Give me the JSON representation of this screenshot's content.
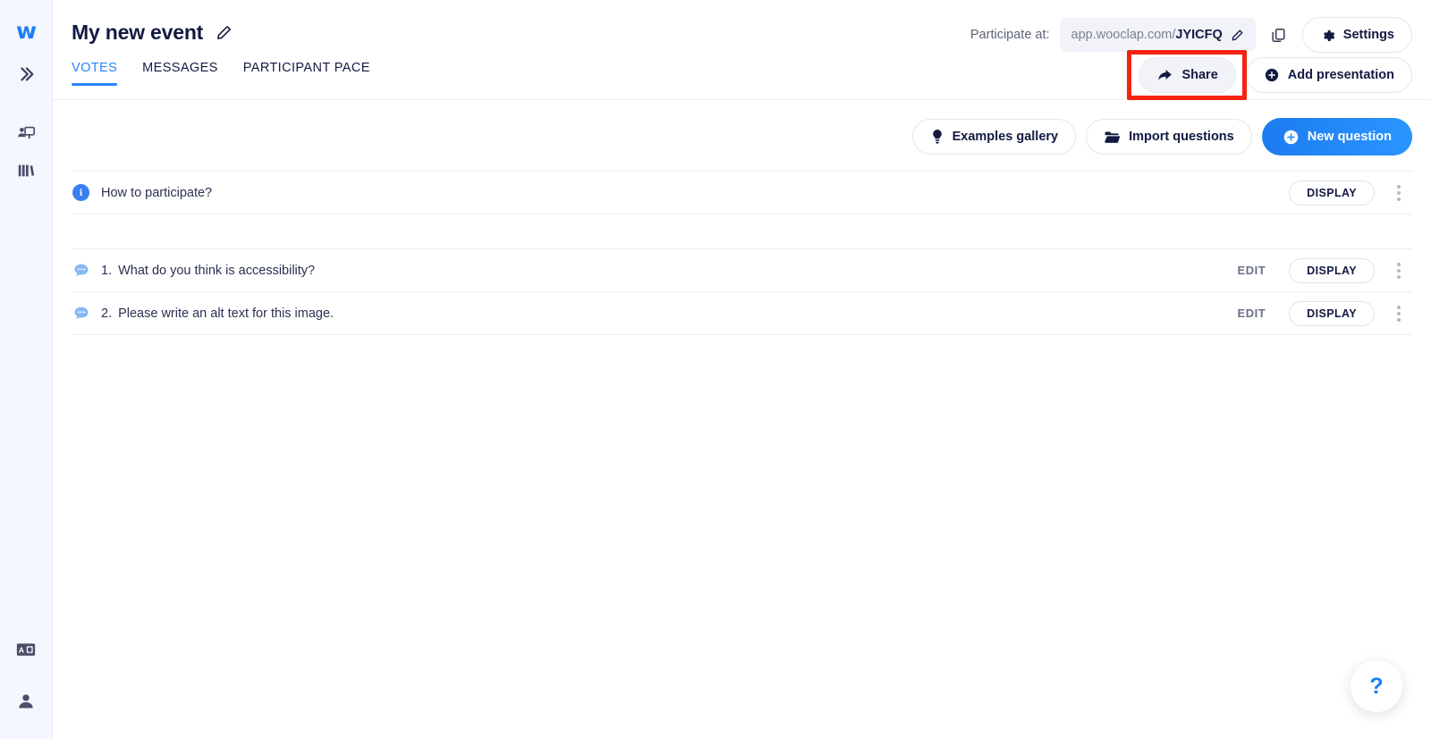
{
  "sidebar": {
    "logo_label": "w",
    "expand_icon": "double-chevron-right-icon",
    "items": [
      {
        "icon": "presenter-screen-icon",
        "name": "presentations"
      },
      {
        "icon": "bookshelf-icon",
        "name": "library"
      }
    ],
    "bottom_items": [
      {
        "icon": "language-icon",
        "name": "language"
      },
      {
        "icon": "user-icon",
        "name": "account"
      }
    ]
  },
  "header": {
    "event_title": "My new event",
    "edit_title_icon": "pencil-icon",
    "tabs": [
      {
        "label": "VOTES",
        "active": true
      },
      {
        "label": "MESSAGES",
        "active": false
      },
      {
        "label": "PARTICIPANT PACE",
        "active": false
      }
    ],
    "participate_label": "Participate at:",
    "participate_url_prefix": "app.wooclap.com/",
    "participate_code": "JYICFQ",
    "url_edit_icon": "pencil-icon",
    "copy_icon": "copy-icon",
    "settings_label": "Settings",
    "settings_icon": "gear-icon",
    "share_label": "Share",
    "share_icon": "share-arrow-icon",
    "add_presentation_label": "Add presentation",
    "add_presentation_icon": "plus-circle-icon",
    "highlight_color": "#f42211"
  },
  "actions": {
    "examples_gallery_label": "Examples gallery",
    "examples_gallery_icon": "lightbulb-icon",
    "import_questions_label": "Import questions",
    "import_questions_icon": "folder-icon",
    "new_question_label": "New question",
    "new_question_icon": "plus-circle-icon",
    "primary_color": "#1b7cf0"
  },
  "list": {
    "info_row": {
      "icon": "info-circle-icon",
      "label": "How to participate?",
      "display_label": "DISPLAY",
      "menu_icon": "kebab-menu-icon"
    },
    "questions": [
      {
        "icon": "speech-bubble-icon",
        "number": "1.",
        "text": "What do you think is accessibility?",
        "edit_label": "EDIT",
        "display_label": "DISPLAY",
        "menu_icon": "kebab-menu-icon"
      },
      {
        "icon": "speech-bubble-icon",
        "number": "2.",
        "text": "Please write an alt text for this image.",
        "edit_label": "EDIT",
        "display_label": "DISPLAY",
        "menu_icon": "kebab-menu-icon"
      }
    ]
  },
  "help": {
    "label": "?",
    "icon": "question-mark-icon"
  }
}
